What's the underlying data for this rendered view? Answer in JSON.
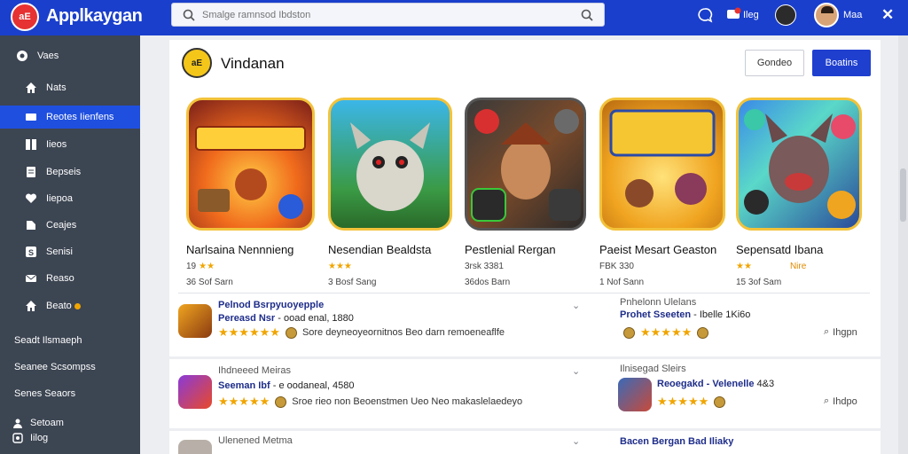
{
  "app": {
    "title": "Applkaygan",
    "logo_text": "aE"
  },
  "search": {
    "placeholder": "Smalge ramnsod Ibdston"
  },
  "topbar": {
    "notif_label": "Ileg",
    "user_label": "Maa"
  },
  "sidebar": {
    "items": [
      {
        "label": "Vaes",
        "icon": "compass-icon"
      },
      {
        "label": "Nats",
        "icon": "home-icon"
      },
      {
        "label": "Reotes Iienfens",
        "icon": "star-icon",
        "active": true
      },
      {
        "label": "Iieos",
        "icon": "grid-icon"
      },
      {
        "label": "Bepseis",
        "icon": "doc-icon"
      },
      {
        "label": "Iiepoa",
        "icon": "heart-icon"
      },
      {
        "label": "Ceajes",
        "icon": "list-icon"
      },
      {
        "label": "Senisi",
        "icon": "s-icon"
      },
      {
        "label": "Reaso",
        "icon": "mail-icon"
      },
      {
        "label": "Beato",
        "icon": "home-icon"
      }
    ],
    "extra": [
      "Seadt Ilsmaeph",
      "Seanee Scsompss",
      "Senes Seaors"
    ],
    "footer": [
      {
        "label": "Setoam",
        "icon": "person-icon"
      },
      {
        "label": "Iilog",
        "icon": "logout-icon"
      }
    ]
  },
  "section": {
    "title": "Vindanan",
    "badge_text": "aE",
    "btn_secondary": "Gondeo",
    "btn_primary": "Boatins"
  },
  "featured": [
    {
      "name": "Narlsaina Nennnieng",
      "meta": "19",
      "stars": "★★",
      "sub": "36 Sof Sarn",
      "tag": "",
      "theme": "fire"
    },
    {
      "name": "Nesendian Bealdsta",
      "meta": "",
      "stars": "★★★",
      "sub": "3 Bosf Sang",
      "tag": "",
      "theme": "jungle"
    },
    {
      "name": "Pestlenial Rergan",
      "meta": "3rsk 3381",
      "stars": "",
      "sub": "36dos Barn",
      "tag": "",
      "theme": "warrior"
    },
    {
      "name": "Paeist Mesart Geaston",
      "meta": "FBK 330",
      "stars": "",
      "sub": "1 Nof Sann",
      "tag": "",
      "theme": "gold"
    },
    {
      "name": "Sepensatd Ibana",
      "meta": "",
      "stars": "★★",
      "sub": "15 3of Sam",
      "tag": "Nire",
      "theme": "wolf"
    }
  ],
  "list": [
    {
      "title": "Pelnod Bsrpyuoyepple",
      "sub_left": "Pereasd Nsr",
      "sub_right": "- ooad enal, 1880",
      "stars": "★★★★★★",
      "desc": "Sore deyneoyeornitnos Beo darn remoeneaflfe",
      "right_grey": "Pnhelonn Ulelans",
      "right_title": "Prohet Sseeten",
      "right_mid": "- Ibelle",
      "right_num": "1Ki6o",
      "right_stars": "★★★★★",
      "action": "Ihgpn"
    },
    {
      "title": "Ihdneeed Meiras",
      "sub_left": "Seeman Ibf",
      "sub_right": "- e oodaneal, 4580",
      "stars": "★★★★★",
      "desc": "Sroe rieo non Beoenstmen Ueo Neo makaslelaedeyo",
      "right_grey": "Ilnisegad Sleirs",
      "right_title": "Reoegakd",
      "right_mid": "- Velenelle",
      "right_num": "4&3",
      "right_stars": "★★★★★",
      "action": "Ihdpo"
    },
    {
      "title": "Ulenened Metma",
      "sub_left": "",
      "sub_right": "",
      "stars": "",
      "desc": "",
      "right_grey": "",
      "right_title": "Bacen Bergan Bad Iliaky",
      "right_mid": "",
      "right_num": "",
      "right_stars": "",
      "action": ""
    }
  ],
  "colors": {
    "brand": "#1a3fcc",
    "sidebar": "#3c4552",
    "active": "#1f4fdf",
    "link": "#1e2d8a",
    "star": "#f0a500"
  }
}
